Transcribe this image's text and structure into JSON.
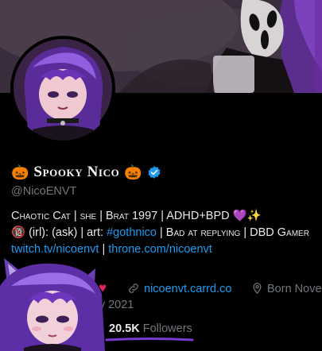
{
  "profile": {
    "display_name": "Spooky Nico",
    "name_emoji_left": "🎃",
    "name_emoji_right": "🎃",
    "handle": "@NicoENVT"
  },
  "bio": {
    "line1_smallcaps": "Chaotic Cat",
    "line1_rest": " | she | Brat 1997 | ADHD+BPD 💜✨",
    "line2_prefix": "🔞 (irl): (ask) | art: ",
    "line2_hashtag": "#gothnico",
    "line2_mid": " | Bad at replying | DBD Gamer",
    "line3_link1": "twitch.tv/nicoenvt",
    "line3_sep": " | ",
    "line3_link2": "throne.com/nicoenvt"
  },
  "meta": {
    "heart": "♥",
    "link_icon": "link-icon",
    "website": "nicoenvt.carrd.co",
    "born_icon": "location-pin-icon",
    "born_text": "Born Nove",
    "joined_text": "ry 2021"
  },
  "stats": {
    "followers_count": "20.5K",
    "followers_label": "Followers"
  },
  "colors": {
    "link": "#1d9bf0",
    "muted": "#71767b",
    "verified": "#1d9bf0",
    "underline": "#7a3bd1",
    "heart": "#e0245e"
  }
}
